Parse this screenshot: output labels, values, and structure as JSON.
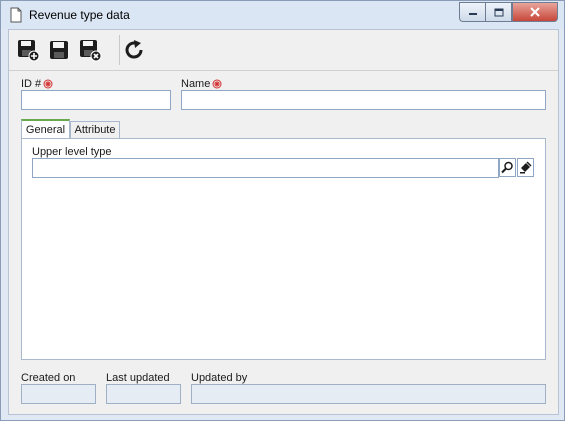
{
  "window": {
    "title": "Revenue type data",
    "title_icon": "document-icon",
    "controls": [
      "minimize-icon",
      "maximize-icon",
      "close-icon"
    ]
  },
  "toolbar": {
    "buttons": [
      {
        "name": "save-new-button",
        "icon": "save-plus-icon"
      },
      {
        "name": "save-button",
        "icon": "save-icon"
      },
      {
        "name": "save-close-button",
        "icon": "save-close-icon"
      },
      {
        "name": "refresh-button",
        "icon": "refresh-icon"
      }
    ]
  },
  "form": {
    "id_label": "ID #",
    "id_value": "",
    "name_label": "Name",
    "name_value": ""
  },
  "tabs": [
    {
      "label": "General",
      "active": true
    },
    {
      "label": "Attribute",
      "active": false
    }
  ],
  "general": {
    "upper_level_label": "Upper level type",
    "upper_level_value": ""
  },
  "footer": {
    "created_on_label": "Created on",
    "created_on_value": "",
    "last_updated_label": "Last updated",
    "last_updated_value": "",
    "updated_by_label": "Updated by",
    "updated_by_value": ""
  },
  "colors": {
    "required_marker": "#d32f2f",
    "active_tab_accent": "#6aa84f",
    "close_button": "#c7463a"
  }
}
